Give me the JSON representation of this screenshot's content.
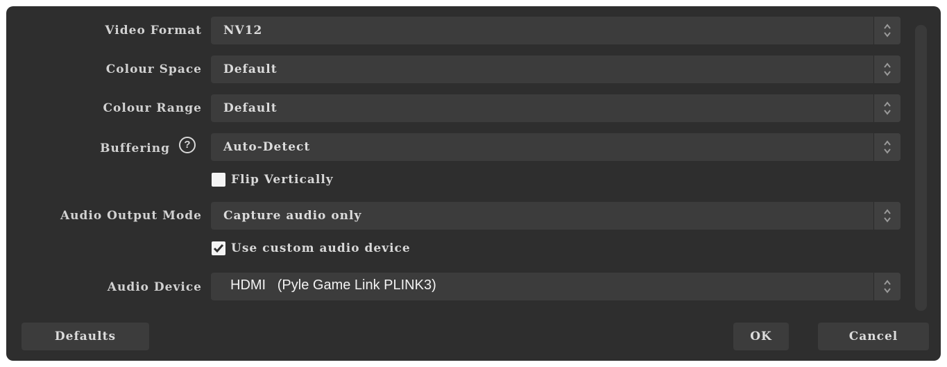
{
  "fields": [
    {
      "label": "Video Format",
      "value": "NV12"
    },
    {
      "label": "Colour Space",
      "value": "Default"
    },
    {
      "label": "Colour Range",
      "value": "Default"
    },
    {
      "label": "Buffering",
      "value": "Auto-Detect"
    },
    {
      "label": "Audio Output Mode",
      "value": "Capture audio only"
    },
    {
      "label": "Audio Device",
      "value": "HDMI   (Pyle Game Link PLINK3)"
    }
  ],
  "buffering_help": "?",
  "flip_vertically": {
    "label": "Flip Vertically",
    "checked": false
  },
  "custom_audio": {
    "label": "Use custom audio device",
    "checked": true
  },
  "buttons": {
    "defaults": "Defaults",
    "ok": "OK",
    "cancel": "Cancel"
  },
  "icons": {
    "combo_arrows": "up-down-chevron-icon",
    "help": "question-circle-icon",
    "checkmark": "checkmark-icon"
  }
}
